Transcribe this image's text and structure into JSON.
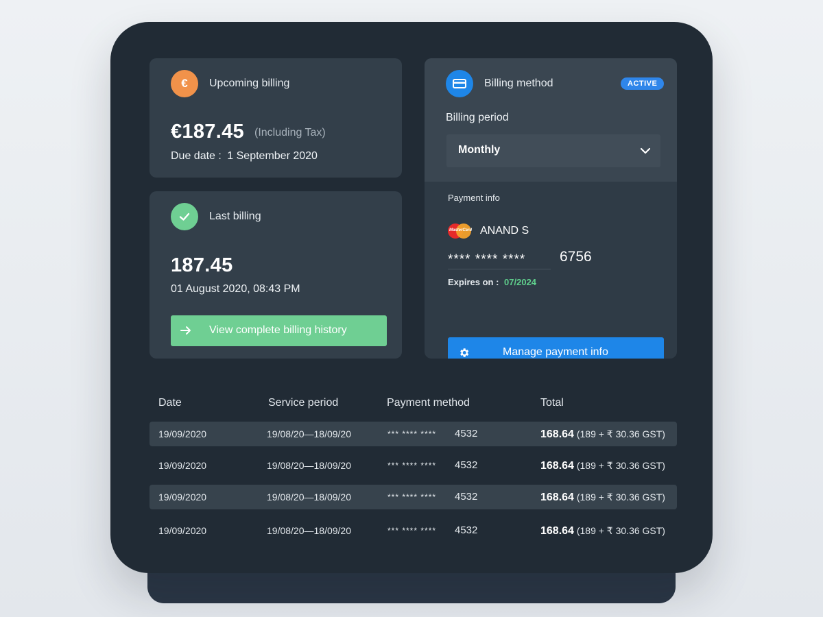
{
  "upcoming": {
    "icon_glyph": "€",
    "title": "Upcoming billing",
    "amount": "€187.45",
    "tax_note": "(Including Tax)",
    "due_label": "Due date :",
    "due_date": "1 September 2020"
  },
  "last": {
    "title": "Last billing",
    "amount": "187.45",
    "datetime": "01 August 2020, 08:43 PM",
    "history_button": "View complete billing history"
  },
  "billing_method": {
    "title": "Billing method",
    "badge": "ACTIVE",
    "period_label": "Billing period",
    "period_value": "Monthly",
    "payment_info_label": "Payment info",
    "card_holder": "ANAND S",
    "card_brand_text": "MasterCard",
    "card_mask": "**** **** ****",
    "card_last4": "6756",
    "expires_label": "Expires on :",
    "expires_value": "07/2024",
    "manage_button": "Manage payment info"
  },
  "table": {
    "headers": [
      "Date",
      "Service period",
      "Payment method",
      "Total"
    ],
    "rows": [
      {
        "date": "19/09/2020",
        "period": "19/08/20—18/09/20",
        "mask": "*** **** ****",
        "last4": "4532",
        "total": "168.64",
        "breakdown": "(189 + ₹ 30.36 GST)"
      },
      {
        "date": "19/09/2020",
        "period": "19/08/20—18/09/20",
        "mask": "*** **** ****",
        "last4": "4532",
        "total": "168.64",
        "breakdown": "(189 + ₹ 30.36 GST)"
      },
      {
        "date": "19/09/2020",
        "period": "19/08/20—18/09/20",
        "mask": "*** **** ****",
        "last4": "4532",
        "total": "168.64",
        "breakdown": "(189 + ₹ 30.36 GST)"
      },
      {
        "date": "19/09/2020",
        "period": "19/08/20—18/09/20",
        "mask": "*** **** ****",
        "last4": "4532",
        "total": "168.64",
        "breakdown": "(189 + ₹ 30.36 GST)"
      }
    ]
  },
  "colors": {
    "card_bg": "#212b35",
    "panel_bg": "#333f4a",
    "orange": "#f1924a",
    "green": "#6fcf93",
    "blue": "#1e86e8",
    "expiry_green": "#5fcf8c"
  }
}
